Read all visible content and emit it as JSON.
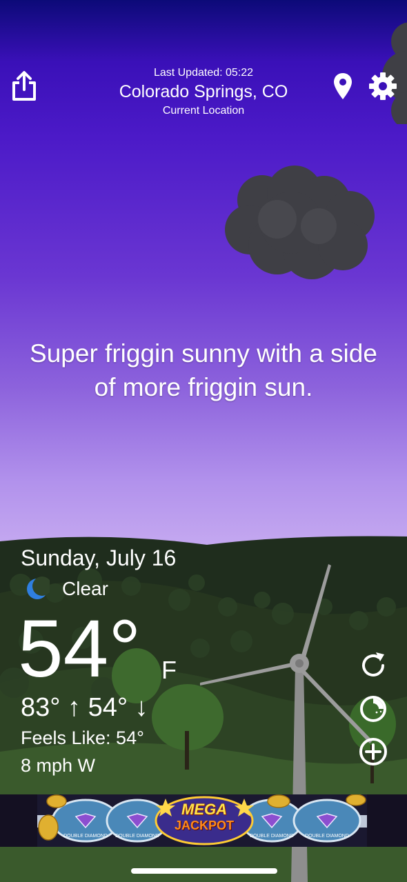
{
  "header": {
    "last_updated": "Last Updated: 05:22",
    "city": "Colorado Springs, CO",
    "location_label": "Current Location"
  },
  "icons": {
    "share": "share-icon",
    "location": "map-pin-icon",
    "settings": "gear-icon",
    "condition": "moon-icon",
    "refresh": "refresh-icon",
    "radar": "radar-icon",
    "add": "plus-circle-icon"
  },
  "forecast": {
    "message": "Super friggin sunny with a side of more friggin sun."
  },
  "current": {
    "date": "Sunday, July 16",
    "condition": "Clear",
    "temperature": "54°",
    "unit": "F",
    "high_low": "83° ↑ 54° ↓",
    "feels_like": "Feels Like: 54°",
    "wind": "8 mph W"
  },
  "ad": {
    "title": "MEGA",
    "subtitle": "JACKPOT",
    "reel_labels": [
      "DOUBLE DIAMOND",
      "DOUBLE DIAMOND",
      "DOUBLE DIAMOND",
      "DOUBLE DIAMOND"
    ]
  },
  "colors": {
    "sky_top": "#0c0a78",
    "sky_mid": "#4c1ac8",
    "sky_bottom": "#c4a8f0",
    "hills_dark": "#22301f",
    "hills_mid": "#2f4526",
    "cloud": "#3f3f45"
  }
}
